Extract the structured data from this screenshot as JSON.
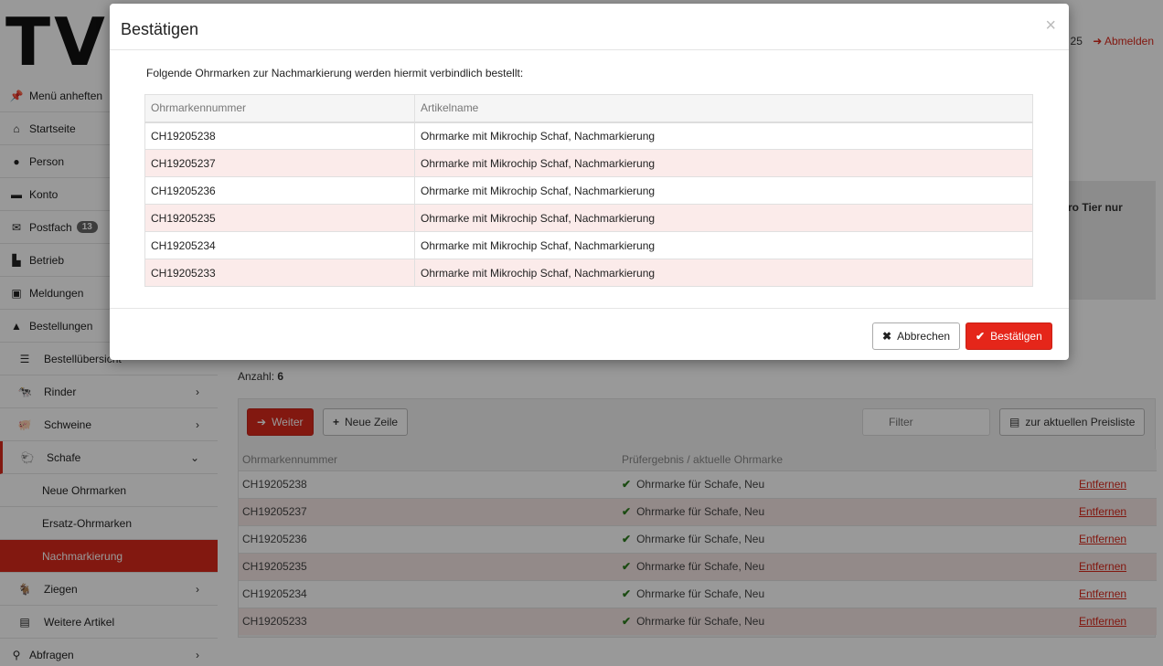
{
  "header": {
    "logo": "TVI",
    "user_suffix": "25",
    "logout": "Abmelden"
  },
  "sidebar": {
    "items": [
      {
        "label": "Menü anheften",
        "icon": "pin-icon"
      },
      {
        "label": "Startseite",
        "icon": "home-icon"
      },
      {
        "label": "Person",
        "icon": "user-icon"
      },
      {
        "label": "Konto",
        "icon": "card-icon"
      },
      {
        "label": "Postfach",
        "icon": "mail-icon",
        "badge": "13"
      },
      {
        "label": "Betrieb",
        "icon": "industry-icon"
      },
      {
        "label": "Meldungen",
        "icon": "clipboard-icon"
      },
      {
        "label": "Bestellungen",
        "icon": "bag-icon"
      }
    ],
    "bestell_items": [
      {
        "label": "Bestellübersicht",
        "icon": "list-icon"
      },
      {
        "label": "Rinder",
        "icon": "cow-icon"
      },
      {
        "label": "Schweine",
        "icon": "pig-icon"
      },
      {
        "label": "Schafe",
        "icon": "sheep-icon"
      }
    ],
    "schafe_items": [
      "Neue Ohrmarken",
      "Ersatz-Ohrmarken",
      "Nachmarkierung"
    ],
    "more_items": [
      {
        "label": "Ziegen",
        "icon": "goat-icon"
      },
      {
        "label": "Weitere Artikel",
        "icon": "box-icon"
      },
      {
        "label": "Abfragen",
        "icon": "search-icon"
      }
    ]
  },
  "main": {
    "info_fragment": "ro Tier nur",
    "count_label": "Anzahl:",
    "count_value": "6",
    "weiter_label": "Weiter",
    "neue_zeile_label": "Neue Zeile",
    "filter_placeholder": "Filter",
    "preisliste_label": "zur aktuellen Preisliste",
    "columns": [
      "Ohrmarkennummer",
      "Prüfergebnis / aktuelle Ohrmarke",
      ""
    ],
    "rows": [
      {
        "number": "CH19205238",
        "result": "Ohrmarke für Schafe, Neu",
        "action": "Entfernen"
      },
      {
        "number": "CH19205237",
        "result": "Ohrmarke für Schafe, Neu",
        "action": "Entfernen"
      },
      {
        "number": "CH19205236",
        "result": "Ohrmarke für Schafe, Neu",
        "action": "Entfernen"
      },
      {
        "number": "CH19205235",
        "result": "Ohrmarke für Schafe, Neu",
        "action": "Entfernen"
      },
      {
        "number": "CH19205234",
        "result": "Ohrmarke für Schafe, Neu",
        "action": "Entfernen"
      },
      {
        "number": "CH19205233",
        "result": "Ohrmarke für Schafe, Neu",
        "action": "Entfernen"
      }
    ]
  },
  "modal": {
    "title": "Bestätigen",
    "intro": "Folgende Ohrmarken zur Nachmarkierung werden hiermit verbindlich bestellt:",
    "columns": [
      "Ohrmarkennummer",
      "Artikelname"
    ],
    "rows": [
      {
        "number": "CH19205238",
        "article": "Ohrmarke mit Mikrochip Schaf, Nachmarkierung"
      },
      {
        "number": "CH19205237",
        "article": "Ohrmarke mit Mikrochip Schaf, Nachmarkierung"
      },
      {
        "number": "CH19205236",
        "article": "Ohrmarke mit Mikrochip Schaf, Nachmarkierung"
      },
      {
        "number": "CH19205235",
        "article": "Ohrmarke mit Mikrochip Schaf, Nachmarkierung"
      },
      {
        "number": "CH19205234",
        "article": "Ohrmarke mit Mikrochip Schaf, Nachmarkierung"
      },
      {
        "number": "CH19205233",
        "article": "Ohrmarke mit Mikrochip Schaf, Nachmarkierung"
      }
    ],
    "cancel_label": "Abbrechen",
    "confirm_label": "Bestätigen"
  },
  "colors": {
    "accent": "#d9281b",
    "success": "#2e7d1f"
  }
}
